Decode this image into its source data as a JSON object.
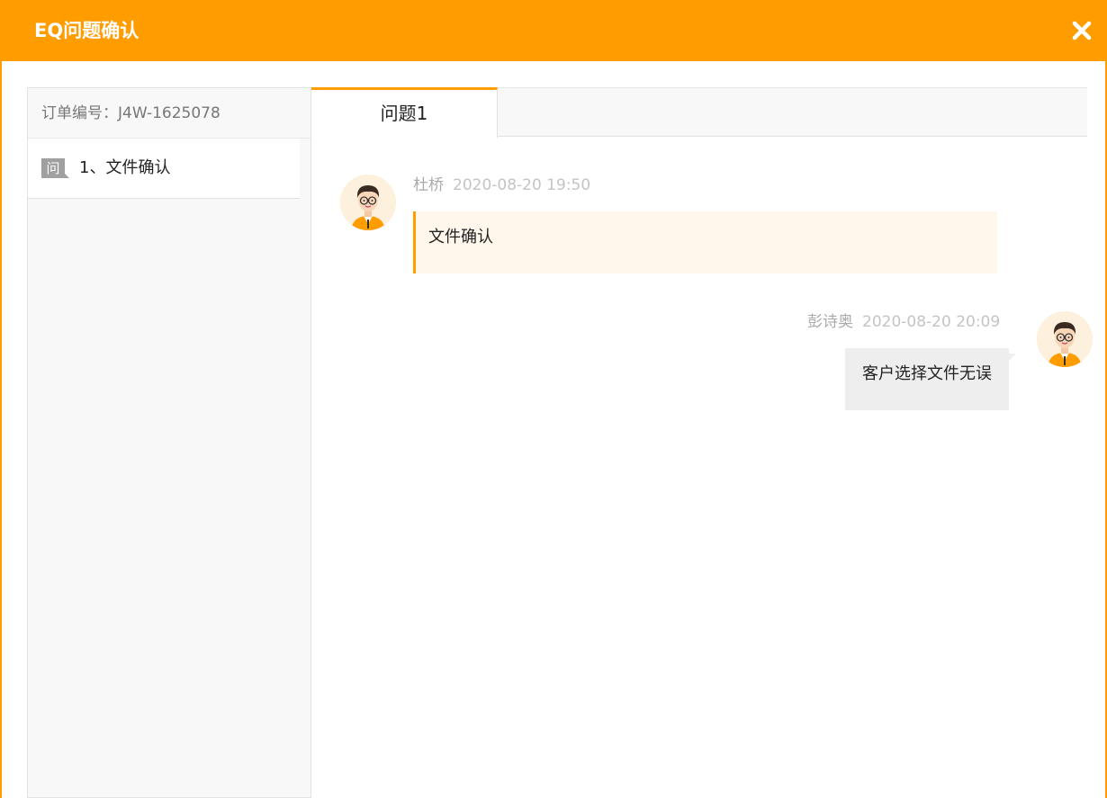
{
  "dialog": {
    "title": "EQ问题确认",
    "close_icon": "close-icon",
    "accent_color": "#ff9c00"
  },
  "sidebar": {
    "order_label": "订单编号：J4W-1625078",
    "questions": [
      {
        "badge": "问",
        "label": "1、文件确认"
      }
    ]
  },
  "tabs": [
    {
      "label": "问题1",
      "active": true
    }
  ],
  "messages": [
    {
      "author": "杜桥",
      "time": "2020-08-20 19:50",
      "text": "文件确认",
      "side": "left",
      "avatar_icon": "user-avatar-icon"
    },
    {
      "author": "彭诗奥",
      "time": "2020-08-20 20:09",
      "text": "客户选择文件无误",
      "side": "right",
      "avatar_icon": "user-avatar-icon"
    }
  ]
}
